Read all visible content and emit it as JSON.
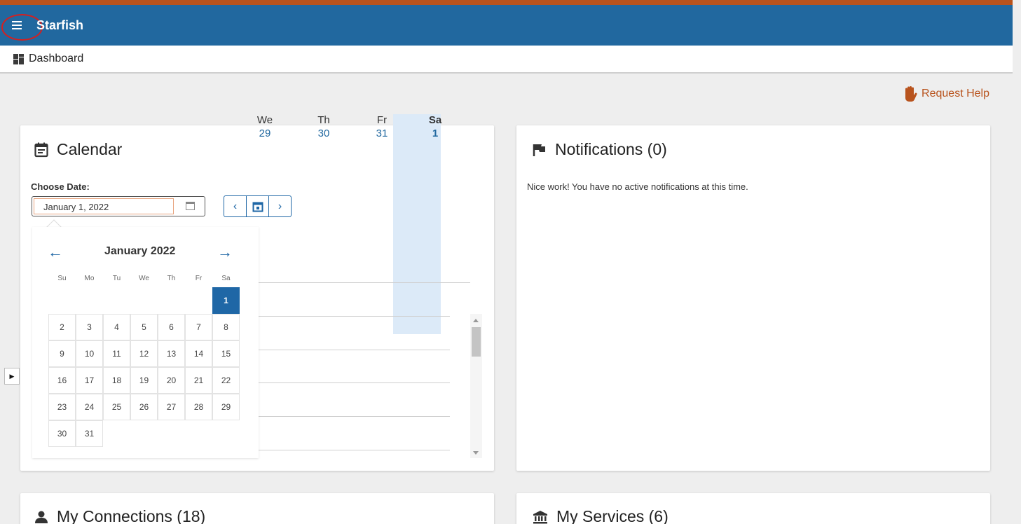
{
  "app": {
    "title": "Starfish"
  },
  "nav": {
    "page": "Dashboard"
  },
  "help": {
    "label": "Request Help"
  },
  "calendar": {
    "title": "Calendar",
    "choose_date_label": "Choose Date:",
    "date_value": "January 1, 2022",
    "days": [
      {
        "name": "We",
        "date": "29"
      },
      {
        "name": "Th",
        "date": "30"
      },
      {
        "name": "Fr",
        "date": "31"
      },
      {
        "name": "Sa",
        "date": "1"
      }
    ],
    "datepicker": {
      "month": "January 2022",
      "prev": "←",
      "next": "→",
      "weekdays": [
        "Su",
        "Mo",
        "Tu",
        "We",
        "Th",
        "Fr",
        "Sa"
      ],
      "dates": [
        "1",
        "2",
        "3",
        "4",
        "5",
        "6",
        "7",
        "8",
        "9",
        "10",
        "11",
        "12",
        "13",
        "14",
        "15",
        "16",
        "17",
        "18",
        "19",
        "20",
        "21",
        "22",
        "23",
        "24",
        "25",
        "26",
        "27",
        "28",
        "29",
        "30",
        "31"
      ],
      "selected": "1"
    }
  },
  "notifications": {
    "title": "Notifications (0)",
    "message": "Nice work! You have no active notifications at this time."
  },
  "connections": {
    "title": "My Connections (18)"
  },
  "services": {
    "title": "My Services (6)"
  },
  "colors": {
    "appbar": "#21689f",
    "accent": "#b8531d",
    "selected": "#1f67a6"
  }
}
